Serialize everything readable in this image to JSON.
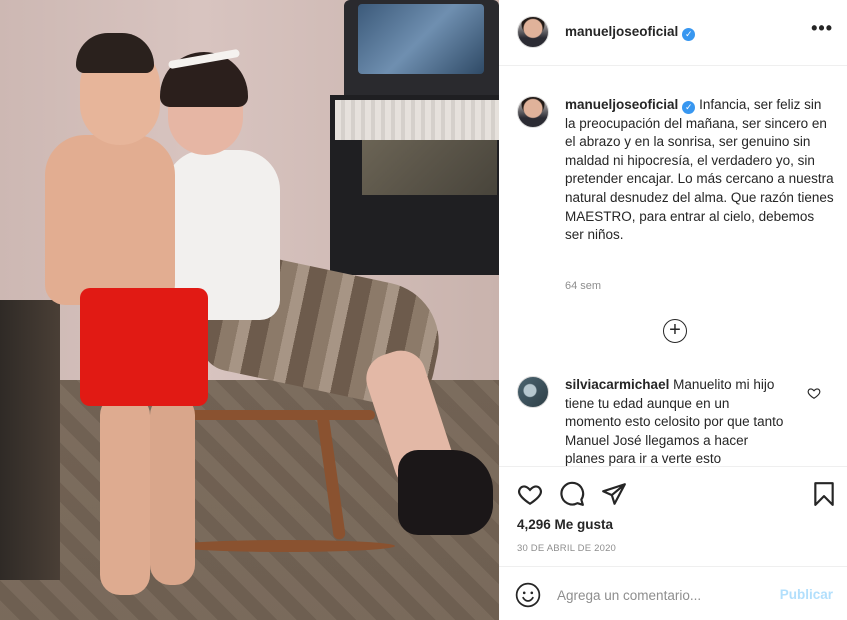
{
  "post": {
    "username": "manueljoseoficial",
    "verified_icon": "✓",
    "more_icon": "•••"
  },
  "caption": {
    "username": "manueljoseoficial",
    "text": "Infancia, ser feliz sin la preocupación del mañana, ser sincero en el abrazo y en la sonrisa, ser genuino sin maldad ni hipocresía, el verdadero yo, sin pretender encajar. Lo más cercano a nuestra natural desnudez del alma. Que razón tienes MAESTRO, para entrar al cielo, debemos ser niños.",
    "time": "64 sem"
  },
  "load_more_icon": "+",
  "comment": {
    "username": "silviacarmichael",
    "text": "Manuelito mi hijo tiene tu edad aunque en un momento esto celosito por que tanto Manuel José llegamos a hacer planes para ir a verte esto"
  },
  "actions": {
    "likes": "4,296 Me gusta",
    "date": "30 DE ABRIL DE 2020"
  },
  "add_comment": {
    "placeholder": "Agrega un comentario...",
    "publish_label": "Publicar"
  }
}
